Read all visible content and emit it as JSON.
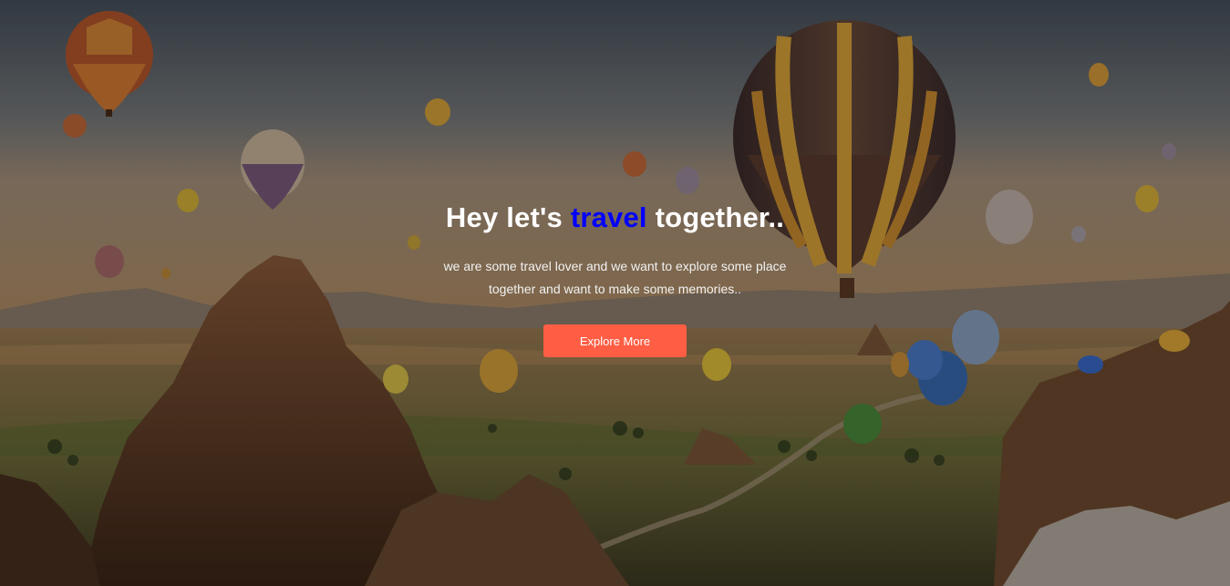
{
  "hero": {
    "headline_before": "Hey let's ",
    "headline_accent": "travel",
    "headline_after": " together..",
    "subtitle_line1": "we are some travel lover and we want to explore some place",
    "subtitle_line2": "together and want to make some memories..",
    "cta_label": "Explore More",
    "background_image": "hot-air-balloons-over-cappadocia"
  },
  "colors": {
    "accent_text": "#0000ff",
    "cta_background": "#ff5e44",
    "text": "#ffffff"
  }
}
